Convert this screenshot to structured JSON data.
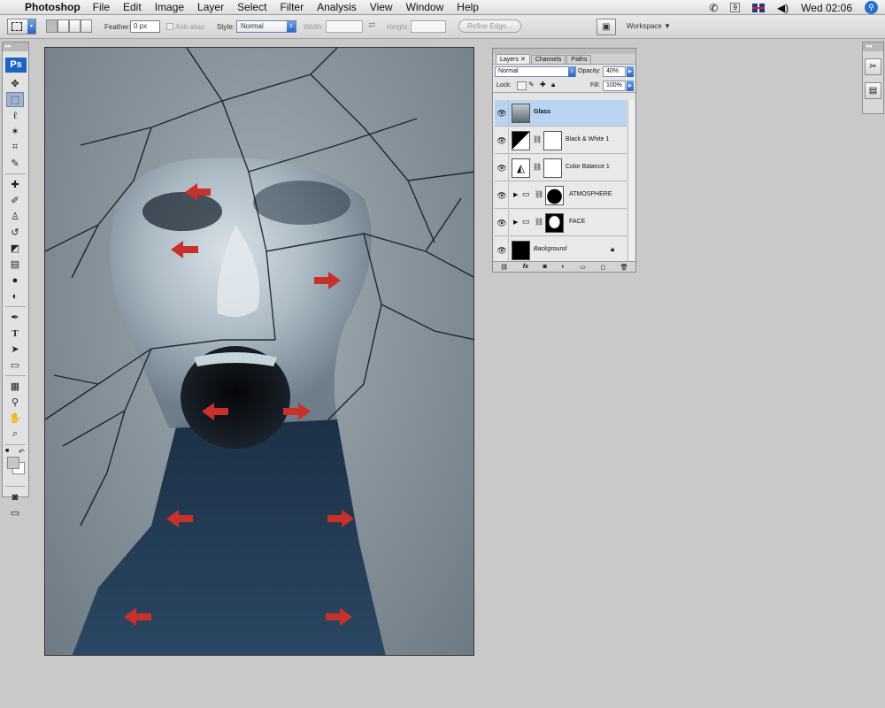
{
  "menubar": {
    "app_name": "Photoshop",
    "items": [
      "File",
      "Edit",
      "Image",
      "Layer",
      "Select",
      "Filter",
      "Analysis",
      "View",
      "Window",
      "Help"
    ],
    "clock": "Wed 02:06"
  },
  "options_bar": {
    "feather_label": "Feather:",
    "feather_value": "0 px",
    "antialias_label": "Anti-alias",
    "style_label": "Style:",
    "style_value": "Normal",
    "width_label": "Width:",
    "height_label": "Height:",
    "refine_edge_label": "Refine Edge...",
    "workspace_label": "Workspace"
  },
  "tools": {
    "logo": "Ps"
  },
  "layers_panel": {
    "tabs": [
      "Layers",
      "Channels",
      "Paths"
    ],
    "blend_mode": "Normal",
    "opacity_label": "Opacity:",
    "opacity_value": "40%",
    "lock_label": "Lock:",
    "fill_label": "Fill:",
    "fill_value": "100%",
    "layers": [
      {
        "name": "Glass",
        "selected": true
      },
      {
        "name": "Black & White 1",
        "selected": false
      },
      {
        "name": "Color Balance 1",
        "selected": false
      },
      {
        "name": "ATMOSPHERE",
        "selected": false
      },
      {
        "name": "FACE",
        "selected": false
      },
      {
        "name": "Background",
        "selected": false
      }
    ]
  },
  "colors": {
    "arrow_red": "#c8302a",
    "selection_blue": "#b9d4f1",
    "ps_blue": "#1c64c4"
  }
}
